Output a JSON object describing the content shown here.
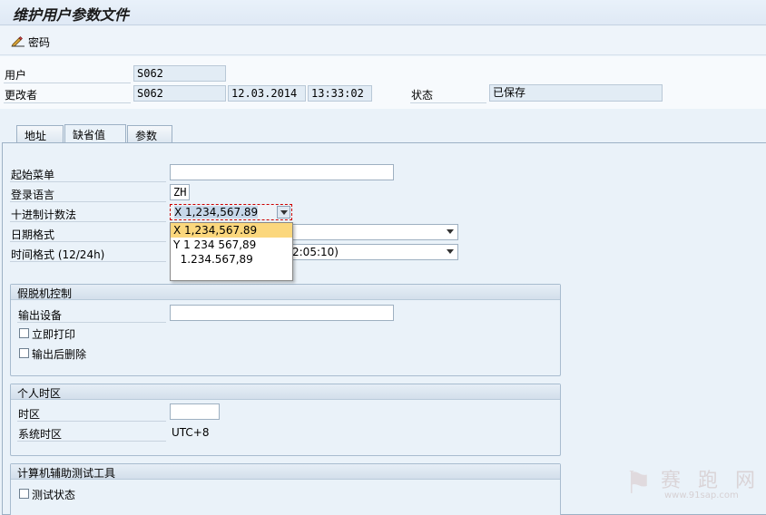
{
  "window": {
    "title": "维护用户参数文件"
  },
  "toolbar": {
    "password_label": "密码"
  },
  "header": {
    "user_label": "用户",
    "user_value": "S062",
    "changed_by_label": "更改者",
    "changed_by_value": "S062",
    "date_value": "12.03.2014",
    "time_value": "13:33:02",
    "status_label": "状态",
    "status_value": "已保存"
  },
  "tabs": [
    {
      "label": "地址",
      "active": false
    },
    {
      "label": "缺省值",
      "active": true
    },
    {
      "label": "参数",
      "active": false
    }
  ],
  "defaults": {
    "start_menu_label": "起始菜单",
    "start_menu_value": "",
    "logon_language_label": "登录语言",
    "logon_language_value": "ZH",
    "decimal_notation_label": "十进制计数法",
    "decimal_notation_value": "X 1,234,567.89",
    "date_format_label": "日期格式",
    "time_format_label": "时间格式 (12/24h)",
    "time_format_value_visible": "2:05:10)"
  },
  "decimal_dropdown": {
    "options": [
      "X 1,234,567.89",
      "Y 1 234 567,89",
      "  1.234.567,89"
    ],
    "highlighted_index": 0
  },
  "spool_group": {
    "title": "假脱机控制",
    "output_device_label": "输出设备",
    "output_device_value": "",
    "print_immediately_label": "立即打印",
    "delete_after_output_label": "输出后删除"
  },
  "timezone_group": {
    "title": "个人时区",
    "timezone_label": "时区",
    "timezone_value": "",
    "system_timezone_label": "系统时区",
    "system_timezone_value": "UTC+8"
  },
  "catt_group": {
    "title": "计算机辅助测试工具",
    "test_status_label": "测试状态"
  },
  "watermark": {
    "text": "赛 跑 网",
    "url": "www.91sap.com"
  },
  "colors": {
    "highlight": "#fbd77d",
    "focus_border": "#cc0000"
  }
}
